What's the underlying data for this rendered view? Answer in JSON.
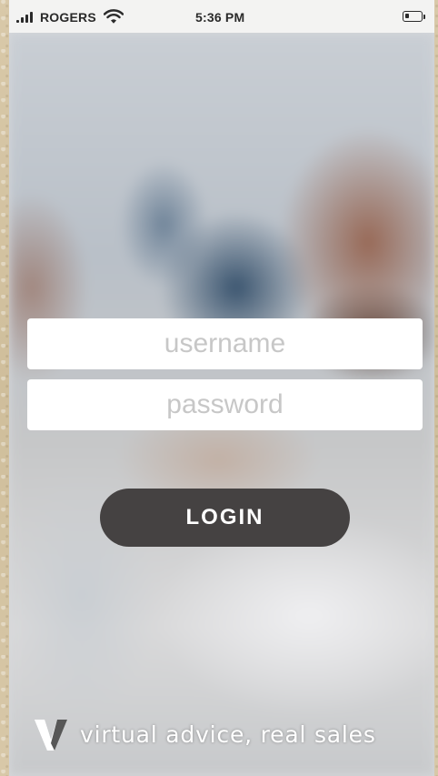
{
  "status_bar": {
    "carrier": "ROGERS",
    "time": "5:36 PM",
    "signal_icon": "cellular-signal-icon",
    "wifi_icon": "wifi-icon",
    "battery_icon": "battery-icon",
    "battery_level": 0.25
  },
  "login_form": {
    "username_placeholder": "username",
    "password_placeholder": "password",
    "username_value": "",
    "password_value": "",
    "login_label": "LOGIN"
  },
  "branding": {
    "logo_icon": "v-logo-icon",
    "tagline": "virtual advice, real sales"
  },
  "colors": {
    "button_background": "#454242",
    "field_background": "#ffffff",
    "placeholder": "#c7c7c7",
    "status_bar_background": "#f3f3f2"
  }
}
